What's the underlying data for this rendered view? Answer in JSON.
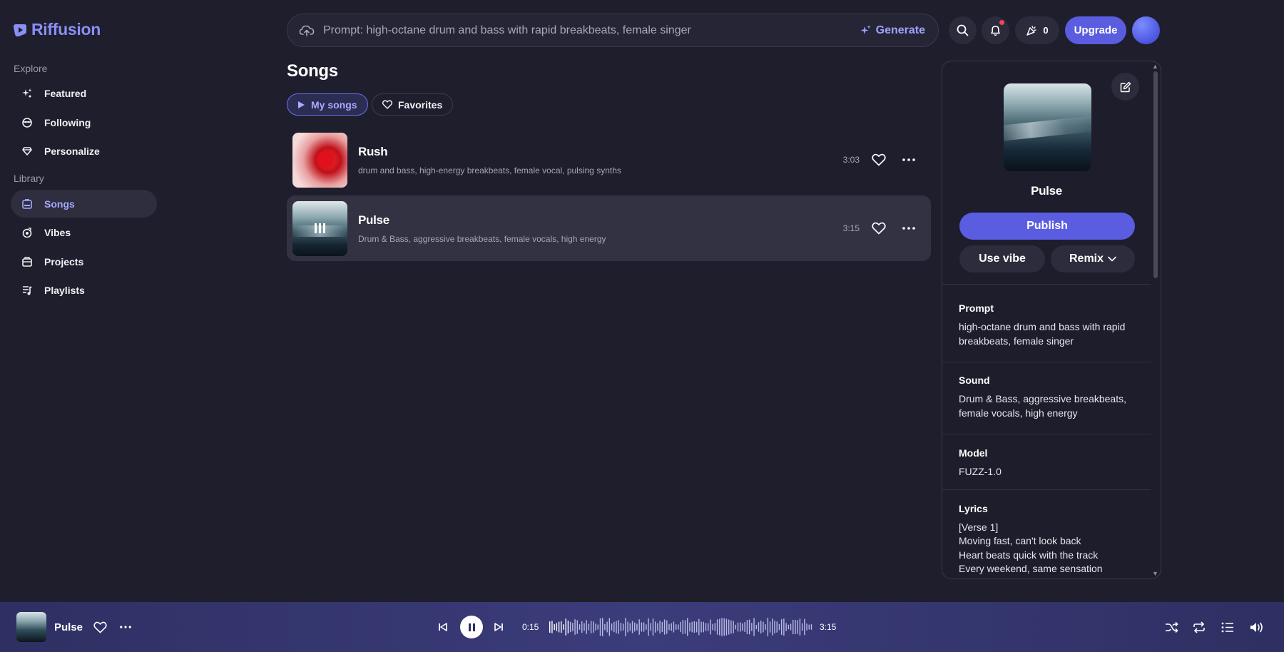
{
  "app": {
    "name": "Riffusion",
    "brand_color": "#8a8ff5",
    "accent": "#5a5de0"
  },
  "sidebar": {
    "explore_label": "Explore",
    "library_label": "Library",
    "explore_items": [
      {
        "label": "Featured",
        "icon": "sparkles-icon"
      },
      {
        "label": "Following",
        "icon": "following-icon"
      },
      {
        "label": "Personalize",
        "icon": "diamond-icon"
      }
    ],
    "library_items": [
      {
        "label": "Songs",
        "icon": "songs-icon",
        "active": true
      },
      {
        "label": "Vibes",
        "icon": "vibes-icon"
      },
      {
        "label": "Projects",
        "icon": "projects-icon"
      },
      {
        "label": "Playlists",
        "icon": "playlists-icon"
      }
    ]
  },
  "topbar": {
    "prompt_placeholder": "Prompt: high-octane drum and bass with rapid breakbeats, female singer",
    "generate_label": "Generate",
    "credits": "0",
    "upgrade_label": "Upgrade"
  },
  "songs_page": {
    "title": "Songs",
    "tabs": [
      {
        "label": "My songs",
        "active": true
      },
      {
        "label": "Favorites",
        "active": false
      }
    ],
    "songs": [
      {
        "title": "Rush",
        "tags": "drum and bass, high-energy breakbeats, female vocal, pulsing synths",
        "duration": "3:03"
      },
      {
        "title": "Pulse",
        "tags": "Drum & Bass, aggressive breakbeats, female vocals, high energy",
        "duration": "3:15",
        "selected": true,
        "playing": true
      }
    ]
  },
  "detail_panel": {
    "title": "Pulse",
    "publish_label": "Publish",
    "use_vibe_label": "Use vibe",
    "remix_label": "Remix",
    "prompt_label": "Prompt",
    "prompt_value": "high-octane drum and bass with rapid breakbeats, female singer",
    "sound_label": "Sound",
    "sound_value": "Drum & Bass, aggressive breakbeats, female vocals, high energy",
    "model_label": "Model",
    "model_value": "FUZZ-1.0",
    "lyrics_label": "Lyrics",
    "lyrics_lines": [
      "[Verse 1]",
      "Moving fast, can't look back",
      "Heart beats quick with the track",
      "Every weekend, same sensation"
    ]
  },
  "player": {
    "title": "Pulse",
    "elapsed": "0:15",
    "total": "3:15",
    "progress": 0.077
  }
}
